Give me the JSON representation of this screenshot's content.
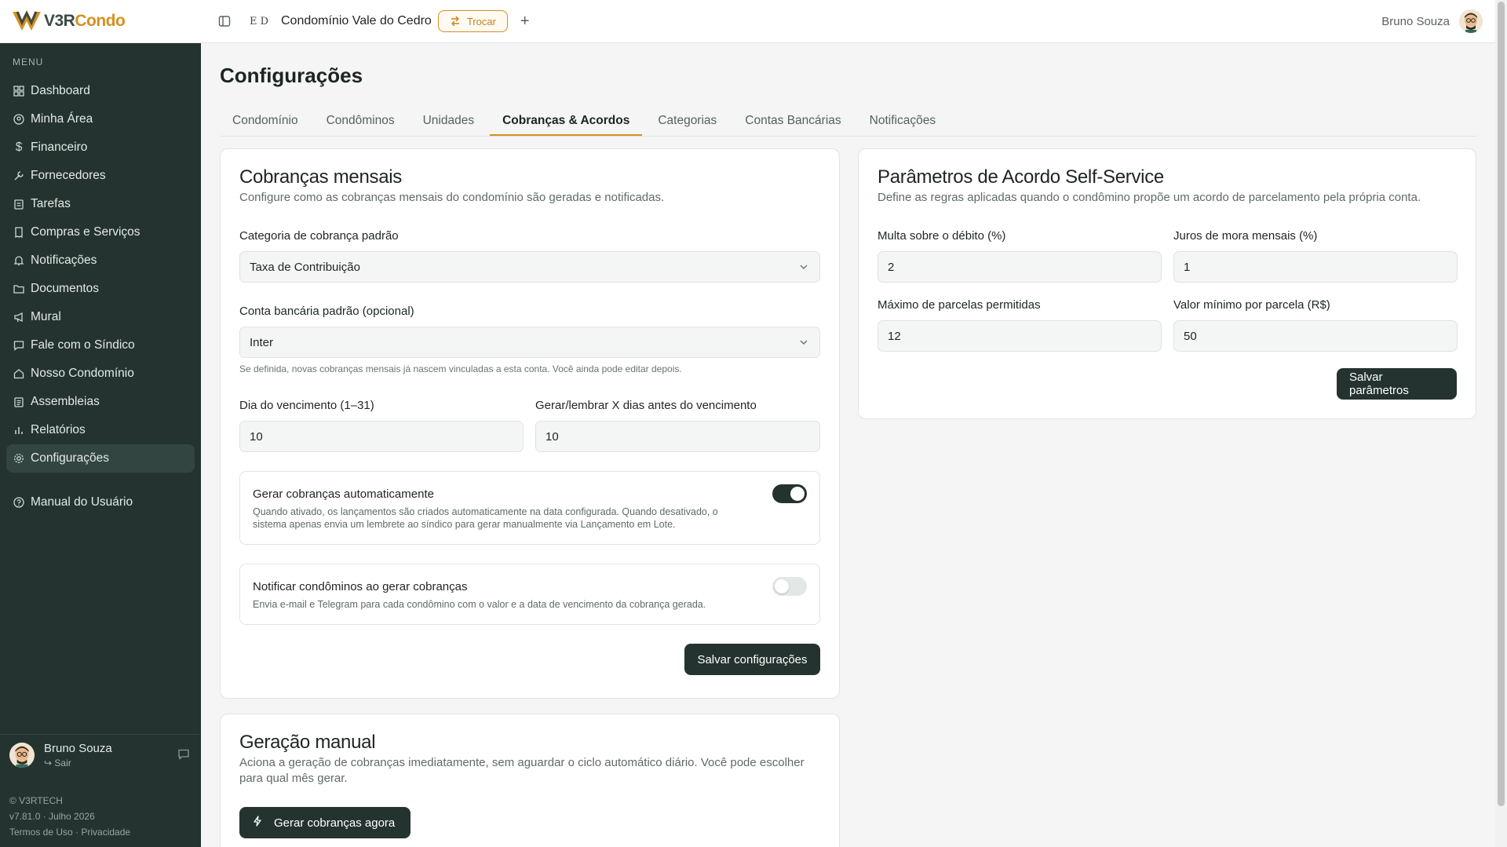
{
  "app": {
    "logo_a": "V3R",
    "logo_b": "Condo",
    "condo_logo_text": "E D",
    "condo_name": "Condomínio Vale do Cedro",
    "swap_label": "Trocar",
    "user_name": "Bruno Souza"
  },
  "sidebar": {
    "menu_label": "MENU",
    "items": [
      {
        "label": "Dashboard",
        "icon": "grid-icon"
      },
      {
        "label": "Minha Área",
        "icon": "user-circle-icon"
      },
      {
        "label": "Financeiro",
        "icon": "dollar-icon"
      },
      {
        "label": "Fornecedores",
        "icon": "wrench-icon"
      },
      {
        "label": "Tarefas",
        "icon": "clipboard-icon"
      },
      {
        "label": "Compras e Serviços",
        "icon": "receipt-icon"
      },
      {
        "label": "Notificações",
        "icon": "bell-icon"
      },
      {
        "label": "Documentos",
        "icon": "folder-icon"
      },
      {
        "label": "Mural",
        "icon": "megaphone-icon"
      },
      {
        "label": "Fale com o Síndico",
        "icon": "chat-icon"
      },
      {
        "label": "Nosso Condomínio",
        "icon": "home-icon"
      },
      {
        "label": "Assembleias",
        "icon": "clipboard-list-icon"
      },
      {
        "label": "Relatórios",
        "icon": "bar-chart-icon"
      },
      {
        "label": "Configurações",
        "icon": "gear-icon"
      }
    ],
    "manual": "Manual do Usuário",
    "user_name": "Bruno Souza",
    "logout": "Sair",
    "copyright": "© V3RTECH",
    "version": "v7.81.0 · Julho 2026",
    "terms": "Termos de Uso",
    "privacy": "Privacidade"
  },
  "page": {
    "title": "Configurações",
    "tabs": [
      "Condomínio",
      "Condôminos",
      "Unidades",
      "Cobranças & Acordos",
      "Categorias",
      "Contas Bancárias",
      "Notificações"
    ]
  },
  "billing": {
    "title": "Cobranças mensais",
    "subtitle": "Configure como as cobranças mensais do condomínio são geradas e notificadas.",
    "category_label": "Categoria de cobrança padrão",
    "category_value": "Taxa de Contribuição",
    "account_label": "Conta bancária padrão (opcional)",
    "account_value": "Inter",
    "account_hint": "Se definida, novas cobranças mensais já nascem vinculadas a esta conta. Você ainda pode editar depois.",
    "due_day_label": "Dia do vencimento (1–31)",
    "due_day_value": "10",
    "days_before_label": "Gerar/lembrar X dias antes do vencimento",
    "days_before_value": "10",
    "auto_title": "Gerar cobranças automaticamente",
    "auto_desc_1": "Quando ativado, os lançamentos são criados automaticamente na data configurada. Quando desativado, o",
    "auto_desc_2": "sistema apenas envia um lembrete ao síndico para gerar manualmente via Lançamento em Lote.",
    "auto_on": true,
    "notify_title": "Notificar condôminos ao gerar cobranças",
    "notify_desc": "Envia e-mail e Telegram para cada condômino com o valor e a data de vencimento da cobrança gerada.",
    "notify_on": false,
    "save_label": "Salvar configurações"
  },
  "agreement": {
    "title": "Parâmetros de Acordo Self-Service",
    "subtitle": "Define as regras aplicadas quando o condômino propõe um acordo de parcelamento pela própria conta.",
    "fine_label": "Multa sobre o débito (%)",
    "fine_value": "2",
    "interest_label": "Juros de mora mensais (%)",
    "interest_value": "1",
    "max_installments_label": "Máximo de parcelas permitidas",
    "max_installments_value": "12",
    "min_installment_label": "Valor mínimo por parcela (R$)",
    "min_installment_value": "50",
    "save_label": "Salvar parâmetros"
  },
  "manual_gen": {
    "title": "Geração manual",
    "subtitle_1": "Aciona a geração de cobranças imediatamente, sem aguardar o ciclo automático diário. Você pode escolher",
    "subtitle_2": "para qual mês gerar.",
    "button_label": "Gerar cobranças agora"
  },
  "colors": {
    "sidebar_bg": "#24332f",
    "accent": "#d6901f",
    "dark_button": "#24332f"
  }
}
